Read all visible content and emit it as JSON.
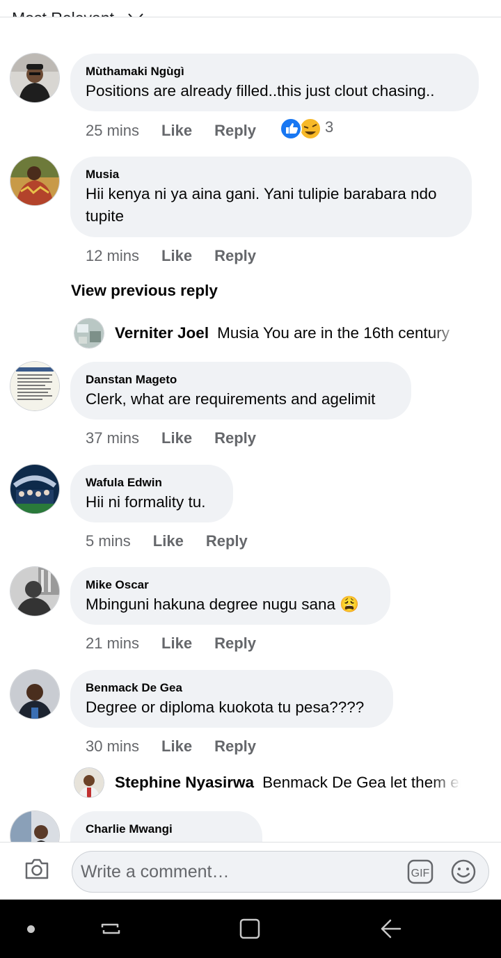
{
  "sort": {
    "label": "Most Relevant"
  },
  "comments": [
    {
      "author": "Mùthamaki Ngùgì",
      "text": "Positions are already filled..this just clout chasing..",
      "time": "25 mins",
      "like": "Like",
      "reply": "Reply",
      "reaction_count": "3"
    },
    {
      "author": "Musia",
      "text": "Hii kenya ni ya aina gani. Yani tulipie barabara ndo tupite",
      "time": "12 mins",
      "like": "Like",
      "reply": "Reply"
    },
    {
      "author": "Danstan Mageto",
      "text": "Clerk, what are requirements and agelimit",
      "time": "37 mins",
      "like": "Like",
      "reply": "Reply"
    },
    {
      "author": "Wafula Edwin",
      "text": "Hii ni formality tu.",
      "time": "5 mins",
      "like": "Like",
      "reply": "Reply"
    },
    {
      "author": "Mike Oscar",
      "text": "Mbinguni hakuna degree nugu sana 😩",
      "time": "21 mins",
      "like": "Like",
      "reply": "Reply"
    },
    {
      "author": "Benmack De Gea",
      "text": "Degree or diploma kuokota tu pesa????",
      "time": "30 mins",
      "like": "Like",
      "reply": "Reply"
    },
    {
      "author": "Charlie Mwangi"
    }
  ],
  "view_previous": "View previous reply",
  "replies": [
    {
      "author": "Verniter Joel",
      "text": "Musia You are in the 16th century"
    },
    {
      "author": "Stephine Nyasirwa",
      "text": "Benmack De Gea let them enjoy"
    }
  ],
  "composer": {
    "placeholder": "Write a comment…",
    "gif": "GIF"
  },
  "colors": {
    "bubble": "#f0f2f5",
    "meta": "#65676b",
    "like_blue": "#1877f2",
    "haha_yellow": "#f7b928"
  }
}
